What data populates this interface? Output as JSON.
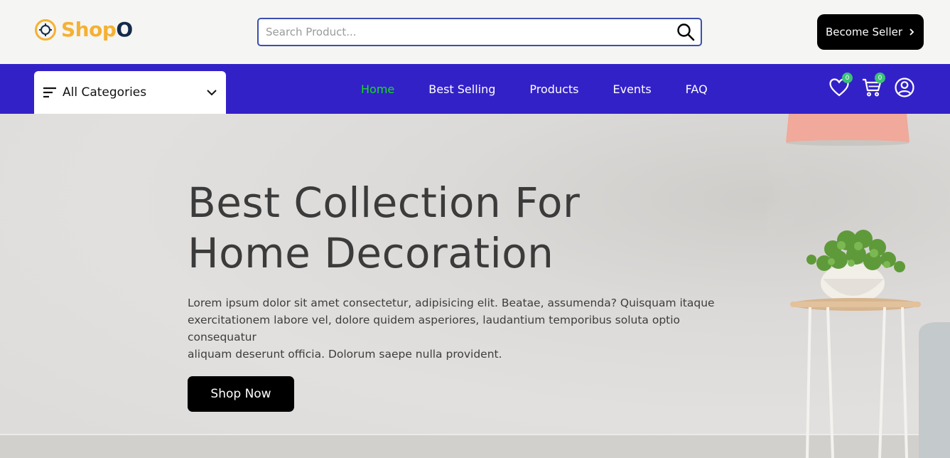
{
  "header": {
    "logo_text_main": "Shop",
    "logo_text_accent": "O",
    "search_placeholder": "Search Product...",
    "seller_button_label": "Become Seller"
  },
  "nav": {
    "categories_label": "All Categories",
    "links": [
      {
        "label": "Home",
        "active": true
      },
      {
        "label": "Best Selling",
        "active": false
      },
      {
        "label": "Products",
        "active": false
      },
      {
        "label": "Events",
        "active": false
      },
      {
        "label": "FAQ",
        "active": false
      }
    ],
    "wishlist_count": "0",
    "cart_count": "0"
  },
  "hero": {
    "title_line1": "Best Collection For",
    "title_line2": "Home Decoration",
    "description_lines": [
      "Lorem ipsum dolor sit amet consectetur, adipisicing elit. Beatae, assumenda? Quisquam itaque",
      "exercitationem labore vel, dolore quidem asperiores, laudantium temporibus soluta optio",
      "consequatur",
      "aliquam deserunt officia. Dolorum saepe nulla provident."
    ],
    "cta_label": "Shop Now"
  },
  "colors": {
    "nav_bg": "#3321c8",
    "active_link": "#17dd1f",
    "logo_accent": "#f5b133",
    "badge": "#3bc177",
    "button_bg": "#000000"
  },
  "icons": [
    "logo-icon",
    "search-icon",
    "chevron-right-icon",
    "menu-lines-icon",
    "chevron-down-icon",
    "heart-icon",
    "cart-icon",
    "user-icon"
  ]
}
